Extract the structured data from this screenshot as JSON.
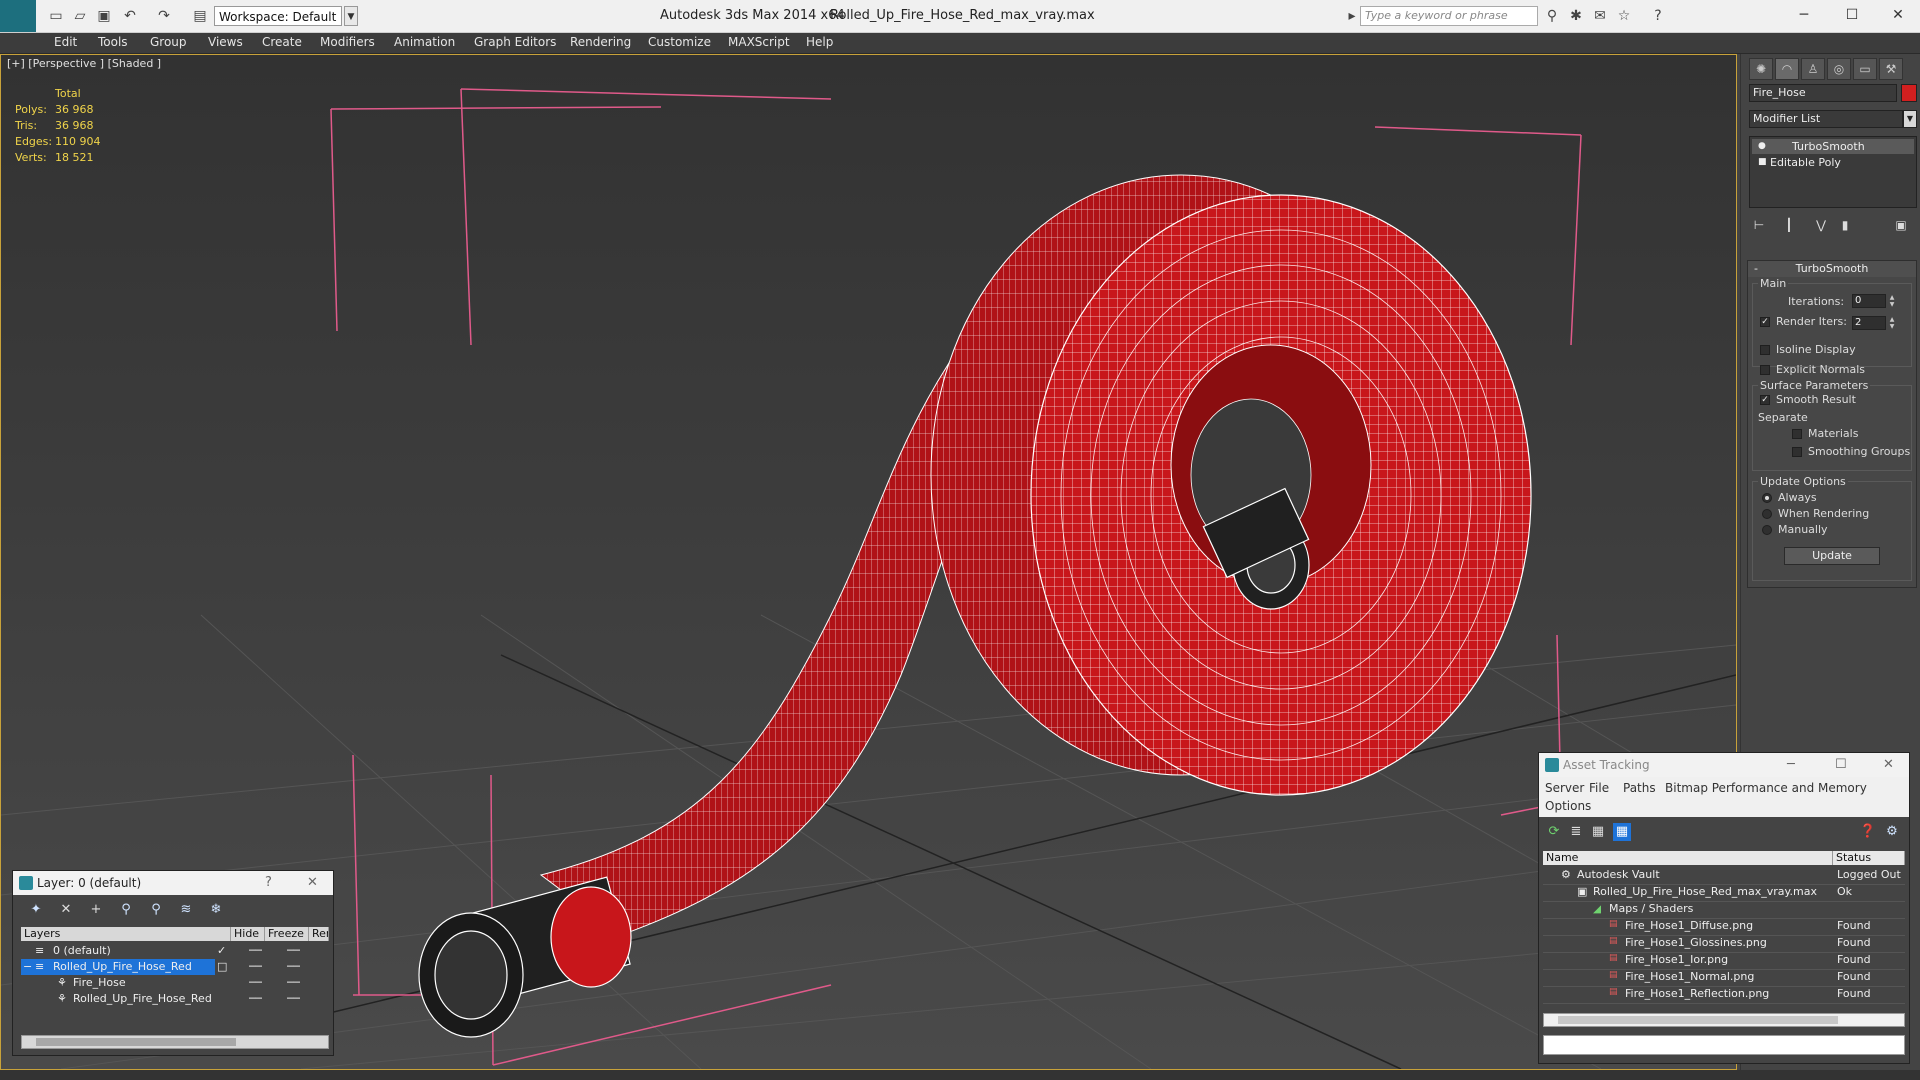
{
  "titlebar": {
    "workspace": "Workspace: Default",
    "app_title": "Autodesk 3ds Max  2014 x64",
    "file_title": "Rolled_Up_Fire_Hose_Red_max_vray.max",
    "search_placeholder": "Type a keyword or phrase"
  },
  "menu": [
    "Edit",
    "Tools",
    "Group",
    "Views",
    "Create",
    "Modifiers",
    "Animation",
    "Graph Editors",
    "Rendering",
    "Customize",
    "MAXScript",
    "Help"
  ],
  "viewport": {
    "label": "[+] [Perspective ] [Shaded ]",
    "stats": {
      "header": "Total",
      "rows": [
        {
          "label": "Polys:",
          "value": "36 968"
        },
        {
          "label": "Tris:",
          "value": "36 968"
        },
        {
          "label": "Edges:",
          "value": "110 904"
        },
        {
          "label": "Verts:",
          "value": "18 521"
        }
      ]
    },
    "mesh_color": "#c8161b",
    "wire_color": "#ffffff",
    "bbox_color": "#e05a8a"
  },
  "command_panel": {
    "object_name": "Fire_Hose",
    "object_color": "#d21f1f",
    "modifier_list": "Modifier List",
    "stack": [
      "TurboSmooth",
      "Editable Poly"
    ],
    "turbosmooth": {
      "title": "TurboSmooth",
      "main_label": "Main",
      "iterations_label": "Iterations:",
      "iterations_value": "0",
      "render_iters_label": "Render Iters:",
      "render_iters_value": "2",
      "isoline_label": "Isoline Display",
      "explicit_label": "Explicit Normals",
      "surface_label": "Surface Parameters",
      "smooth_result_label": "Smooth Result",
      "separate_label": "Separate",
      "materials_label": "Materials",
      "smoothing_groups_label": "Smoothing Groups",
      "update_options_label": "Update Options",
      "always_label": "Always",
      "when_rendering_label": "When Rendering",
      "manually_label": "Manually",
      "update_button": "Update"
    }
  },
  "layer_window": {
    "title": "Layer: 0 (default)",
    "help": "?",
    "columns": [
      "Layers",
      "Hide",
      "Freeze",
      "Ren"
    ],
    "rows": [
      {
        "name": "0 (default)",
        "indent": 0
      },
      {
        "name": "Rolled_Up_Fire_Hose_Red",
        "indent": 0
      },
      {
        "name": "Fire_Hose",
        "indent": 1
      },
      {
        "name": "Rolled_Up_Fire_Hose_Red",
        "indent": 1
      }
    ]
  },
  "asset_window": {
    "title": "Asset Tracking",
    "menu": [
      "Server",
      "File",
      "Paths",
      "Bitmap Performance and Memory",
      "Options"
    ],
    "columns": [
      "Name",
      "Status"
    ],
    "rows": [
      {
        "name": "Autodesk Vault",
        "status": "Logged Out"
      },
      {
        "name": "Rolled_Up_Fire_Hose_Red_max_vray.max",
        "status": "Ok"
      },
      {
        "name": "Maps / Shaders",
        "status": ""
      },
      {
        "name": "Fire_Hose1_Diffuse.png",
        "status": "Found"
      },
      {
        "name": "Fire_Hose1_Glossines.png",
        "status": "Found"
      },
      {
        "name": "Fire_Hose1_Ior.png",
        "status": "Found"
      },
      {
        "name": "Fire_Hose1_Normal.png",
        "status": "Found"
      },
      {
        "name": "Fire_Hose1_Reflection.png",
        "status": "Found"
      }
    ]
  }
}
